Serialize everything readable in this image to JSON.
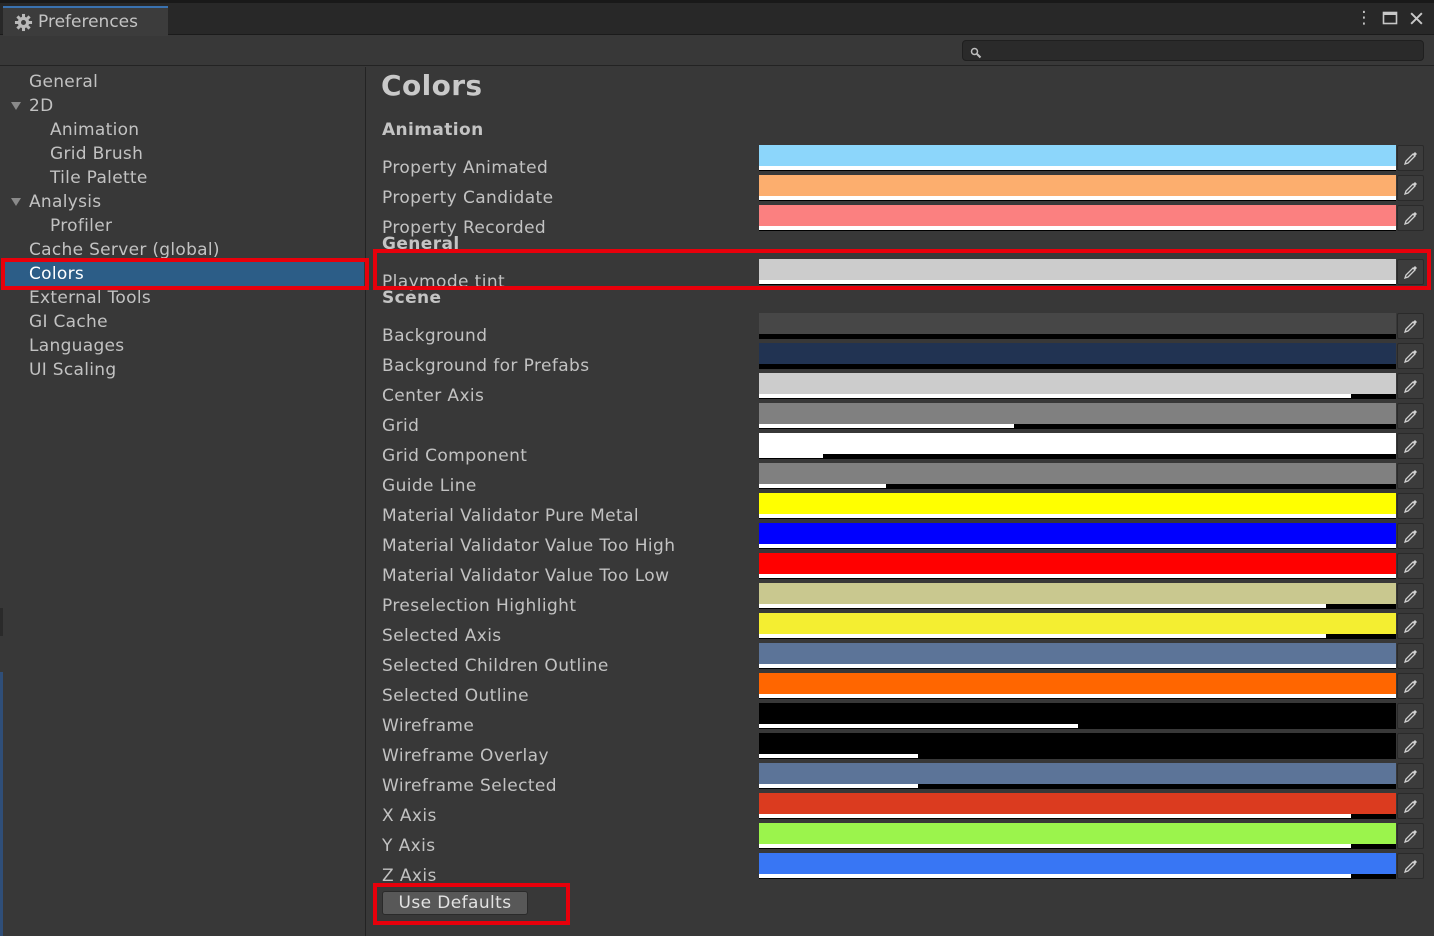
{
  "window": {
    "tab_title": "Preferences",
    "controls": {
      "more": "⋮",
      "maximize": "□",
      "close": "✕"
    }
  },
  "search": {
    "placeholder": "",
    "value": ""
  },
  "sidebar": {
    "items": [
      {
        "label": "General",
        "indent": 0,
        "foldout": false,
        "selected": false
      },
      {
        "label": "2D",
        "indent": 0,
        "foldout": true,
        "selected": false
      },
      {
        "label": "Animation",
        "indent": 1,
        "foldout": false,
        "selected": false
      },
      {
        "label": "Grid Brush",
        "indent": 1,
        "foldout": false,
        "selected": false
      },
      {
        "label": "Tile Palette",
        "indent": 1,
        "foldout": false,
        "selected": false
      },
      {
        "label": "Analysis",
        "indent": 0,
        "foldout": true,
        "selected": false
      },
      {
        "label": "Profiler",
        "indent": 1,
        "foldout": false,
        "selected": false
      },
      {
        "label": "Cache Server (global)",
        "indent": 0,
        "foldout": false,
        "selected": false
      },
      {
        "label": "Colors",
        "indent": 0,
        "foldout": false,
        "selected": true
      },
      {
        "label": "External Tools",
        "indent": 0,
        "foldout": false,
        "selected": false
      },
      {
        "label": "GI Cache",
        "indent": 0,
        "foldout": false,
        "selected": false
      },
      {
        "label": "Languages",
        "indent": 0,
        "foldout": false,
        "selected": false
      },
      {
        "label": "UI Scaling",
        "indent": 0,
        "foldout": false,
        "selected": false
      }
    ]
  },
  "main": {
    "title": "Colors",
    "sections": [
      {
        "heading": "Animation",
        "rows": [
          {
            "label": "Property Animated",
            "color": "#8cd6fb",
            "alpha": 1.0
          },
          {
            "label": "Property Candidate",
            "color": "#fcae6e",
            "alpha": 1.0
          },
          {
            "label": "Property Recorded",
            "color": "#fb8080",
            "alpha": 1.0
          }
        ]
      },
      {
        "heading": "General",
        "rows": [
          {
            "label": "Playmode tint",
            "color": "#cccccc",
            "alpha": 1.0
          }
        ]
      },
      {
        "heading": "Scene",
        "rows": [
          {
            "label": "Background",
            "color": "#474747",
            "alpha": 0.0
          },
          {
            "label": "Background for Prefabs",
            "color": "#213352",
            "alpha": 0.0
          },
          {
            "label": "Center Axis",
            "color": "#cccccc",
            "alpha": 0.93
          },
          {
            "label": "Grid",
            "color": "#808080",
            "alpha": 0.4
          },
          {
            "label": "Grid Component",
            "color": "#ffffff",
            "alpha": 0.1
          },
          {
            "label": "Guide Line",
            "color": "#808080",
            "alpha": 0.2
          },
          {
            "label": "Material Validator Pure Metal",
            "color": "#ffff00",
            "alpha": 1.0
          },
          {
            "label": "Material Validator Value Too High",
            "color": "#0000ff",
            "alpha": 1.0
          },
          {
            "label": "Material Validator Value Too Low",
            "color": "#ff0000",
            "alpha": 1.0
          },
          {
            "label": "Preselection Highlight",
            "color": "#c9c88f",
            "alpha": 0.89
          },
          {
            "label": "Selected Axis",
            "color": "#f4ee31",
            "alpha": 0.89
          },
          {
            "label": "Selected Children Outline",
            "color": "#5c7498",
            "alpha": 1.0
          },
          {
            "label": "Selected Outline",
            "color": "#ff6600",
            "alpha": 1.0
          },
          {
            "label": "Wireframe",
            "color": "#000000",
            "alpha": 0.5
          },
          {
            "label": "Wireframe Overlay",
            "color": "#000000",
            "alpha": 0.25
          },
          {
            "label": "Wireframe Selected",
            "color": "#5c7498",
            "alpha": 0.25
          },
          {
            "label": "X Axis",
            "color": "#db3b1f",
            "alpha": 0.93
          },
          {
            "label": "Y Axis",
            "color": "#9bf44c",
            "alpha": 0.93
          },
          {
            "label": "Z Axis",
            "color": "#3876f4",
            "alpha": 0.93
          }
        ]
      }
    ],
    "use_defaults_label": "Use Defaults"
  },
  "colors": {
    "selection": "#2c5d87",
    "highlight_box": "#e8000b",
    "tab_accent": "#3a72b0"
  }
}
